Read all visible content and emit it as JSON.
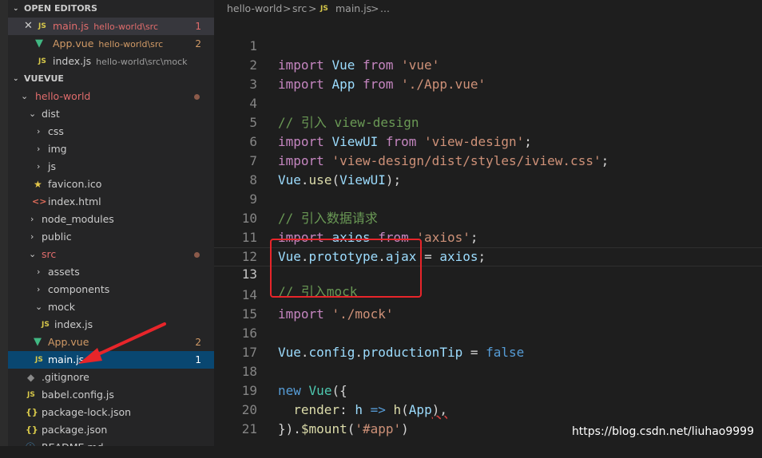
{
  "sidebar": {
    "open_editors_title": "OPEN EDITORS",
    "open_editors": [
      {
        "name": "main.js",
        "desc": "hello-world\\src",
        "badge": "1"
      },
      {
        "name": "App.vue",
        "desc": "hello-world\\src",
        "badge": "2"
      },
      {
        "name": "index.js",
        "desc": "hello-world\\src\\mock",
        "badge": ""
      }
    ],
    "workspace_title": "VUEVUE",
    "tree": {
      "hello_world": "hello-world",
      "dist": "dist",
      "css": "css",
      "img": "img",
      "js": "js",
      "favicon": "favicon.ico",
      "index_html": "index.html",
      "node_modules": "node_modules",
      "public": "public",
      "src": "src",
      "assets": "assets",
      "components": "components",
      "mock": "mock",
      "mock_index": "index.js",
      "app_vue": "App.vue",
      "app_vue_badge": "2",
      "main_js": "main.js",
      "main_js_badge": "1",
      "gitignore": ".gitignore",
      "babel_config": "babel.config.js",
      "package_lock": "package-lock.json",
      "package_json": "package.json",
      "readme": "README.md"
    },
    "icons": {
      "js": "JS",
      "vue": "▼",
      "star": "★",
      "html": "<>",
      "git": "◆",
      "json": "{}",
      "readme": "ⓘ",
      "chevron_down": "⌄",
      "chevron_right": "›",
      "close": "✕"
    }
  },
  "breadcrumb": {
    "part1": "hello-world",
    "sep": ">",
    "part2": "src",
    "file_icon": "JS",
    "part3": "main.js",
    "part4": "..."
  },
  "editor": {
    "line_numbers": [
      "1",
      "2",
      "3",
      "4",
      "5",
      "6",
      "7",
      "8",
      "9",
      "10",
      "11",
      "12",
      "13",
      "14",
      "15",
      "16",
      "17",
      "18",
      "19",
      "20",
      "21"
    ],
    "current_line": 13,
    "tokens": {
      "import": "import",
      "from": "from",
      "Vue": "Vue",
      "App": "App",
      "str_vue": "'vue'",
      "str_app": "'./App.vue'",
      "com_view_design": "// 引入 view-design",
      "ViewUI": "ViewUI",
      "str_view_design": "'view-design'",
      "str_iview_css": "'view-design/dist/styles/iview.css'",
      "use": "use",
      "com_data": "// 引入数据请求",
      "axios": "axios",
      "str_axios": "'axios'",
      "prototype": "prototype",
      "ajax": "ajax",
      "com_mock": "// 引入mock",
      "str_mock": "'./mock'",
      "config": "config",
      "productionTip": "productionTip",
      "false": "false",
      "new": "new",
      "render": "render",
      "h": "h",
      "mount": "$mount",
      "str_app_id": "'#app'"
    }
  },
  "watermark": "https://blog.csdn.net/liuhao9999",
  "colors": {
    "annotation_red": "#e8252a",
    "selected_row": "#094771",
    "error_red": "#e06c6c"
  }
}
